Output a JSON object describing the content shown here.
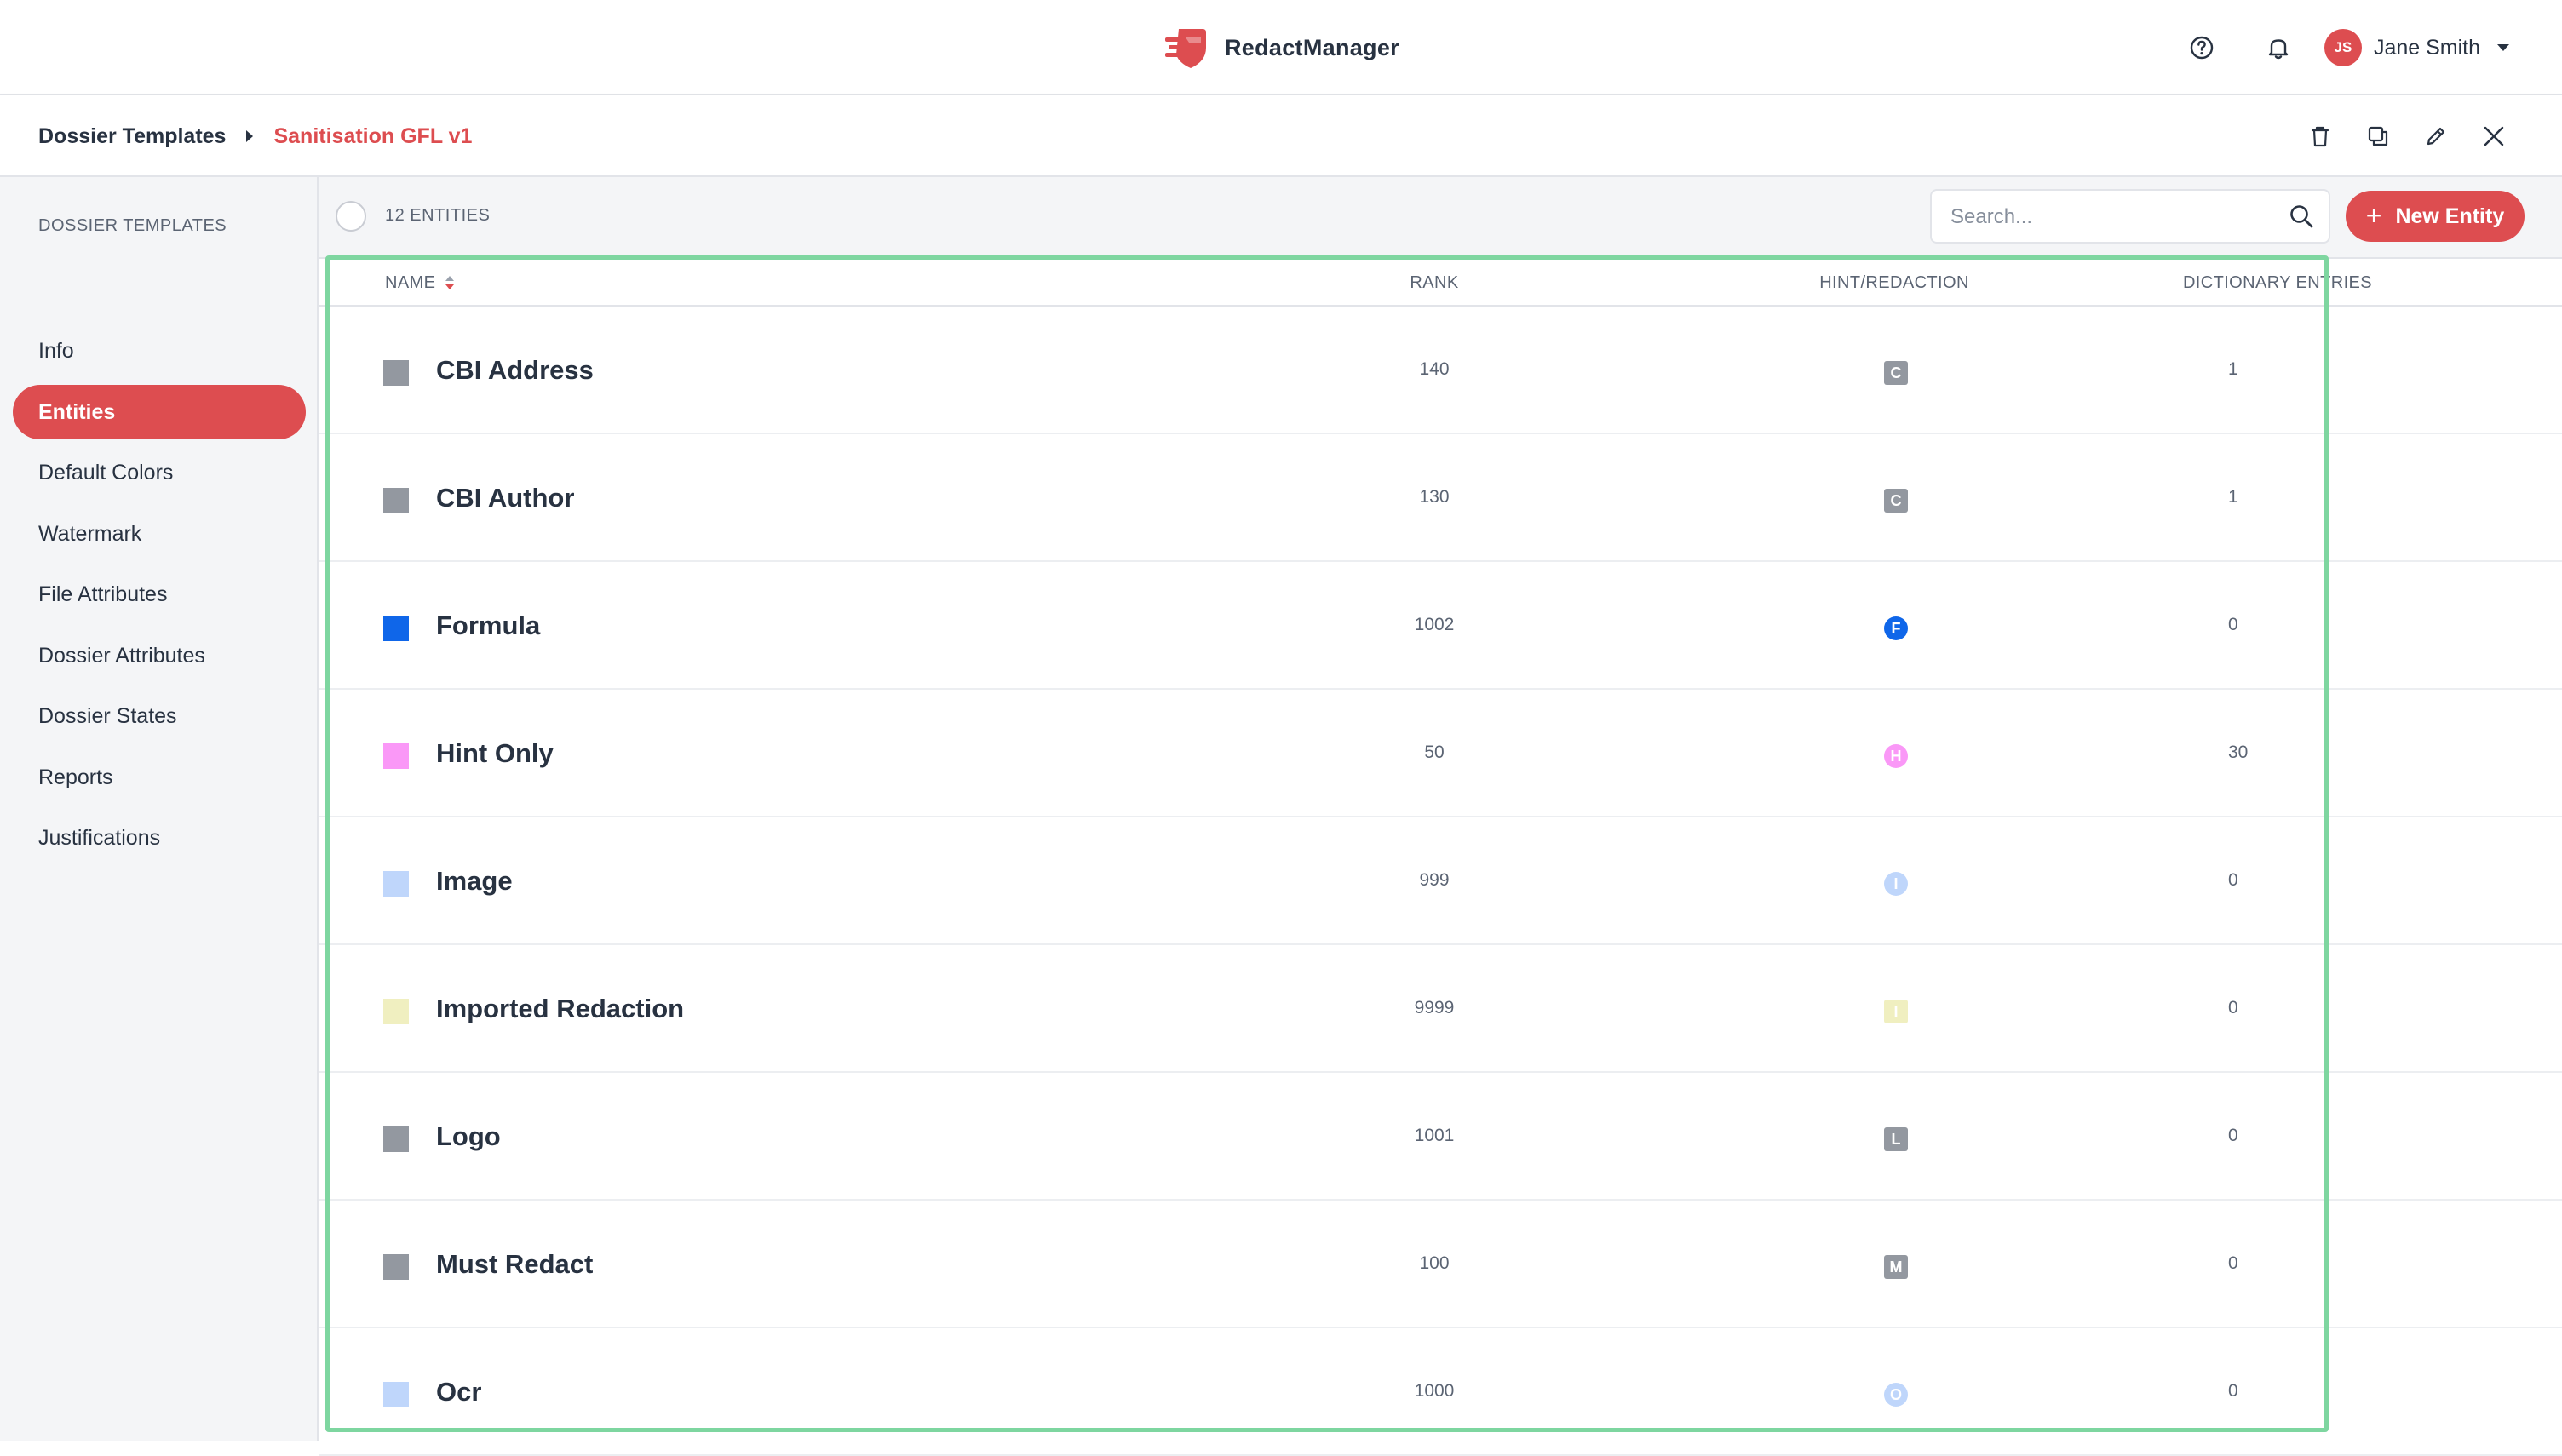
{
  "app": {
    "name": "RedactManager",
    "brand_color": "#dd4d50"
  },
  "user": {
    "initials": "JS",
    "name": "Jane Smith"
  },
  "breadcrumb": {
    "parent": "Dossier Templates",
    "current": "Sanitisation GFL v1"
  },
  "sidebar": {
    "heading": "DOSSIER TEMPLATES",
    "items": [
      {
        "label": "Info",
        "active": false
      },
      {
        "label": "Entities",
        "active": true
      },
      {
        "label": "Default Colors",
        "active": false
      },
      {
        "label": "Watermark",
        "active": false
      },
      {
        "label": "File Attributes",
        "active": false
      },
      {
        "label": "Dossier Attributes",
        "active": false
      },
      {
        "label": "Dossier States",
        "active": false
      },
      {
        "label": "Reports",
        "active": false
      },
      {
        "label": "Justifications",
        "active": false
      }
    ]
  },
  "listbar": {
    "count_label": "12 ENTITIES",
    "search_placeholder": "Search...",
    "new_button_plus": "+",
    "new_button_label": "New Entity"
  },
  "table": {
    "headers": {
      "name": "NAME",
      "rank": "RANK",
      "hint": "HINT/REDACTION",
      "dict": "DICTIONARY ENTRIES"
    },
    "rows": [
      {
        "name": "CBI Address",
        "color": "#9398a0",
        "rank": "140",
        "badge": "C",
        "badge_shape": "square",
        "badge_color": "#9398a0",
        "entries": "1"
      },
      {
        "name": "CBI Author",
        "color": "#9398a0",
        "rank": "130",
        "badge": "C",
        "badge_shape": "square",
        "badge_color": "#9398a0",
        "entries": "1"
      },
      {
        "name": "Formula",
        "color": "#0f66e9",
        "rank": "1002",
        "badge": "F",
        "badge_shape": "circle",
        "badge_color": "#0f66e9",
        "entries": "0"
      },
      {
        "name": "Hint Only",
        "color": "#fa98f7",
        "rank": "50",
        "badge": "H",
        "badge_shape": "circle",
        "badge_color": "#fa98f7",
        "entries": "30"
      },
      {
        "name": "Image",
        "color": "#bfd6fb",
        "rank": "999",
        "badge": "I",
        "badge_shape": "circle",
        "badge_color": "#bfd6fb",
        "entries": "0"
      },
      {
        "name": "Imported Redaction",
        "color": "#f0efc0",
        "rank": "9999",
        "badge": "I",
        "badge_shape": "square",
        "badge_color": "#f0efc0",
        "entries": "0"
      },
      {
        "name": "Logo",
        "color": "#9398a0",
        "rank": "1001",
        "badge": "L",
        "badge_shape": "square",
        "badge_color": "#9398a0",
        "entries": "0"
      },
      {
        "name": "Must Redact",
        "color": "#9398a0",
        "rank": "100",
        "badge": "M",
        "badge_shape": "square",
        "badge_color": "#9398a0",
        "entries": "0"
      },
      {
        "name": "Ocr",
        "color": "#bfd6fb",
        "rank": "1000",
        "badge": "O",
        "badge_shape": "circle",
        "badge_color": "#bfd6fb",
        "entries": "0"
      }
    ]
  }
}
